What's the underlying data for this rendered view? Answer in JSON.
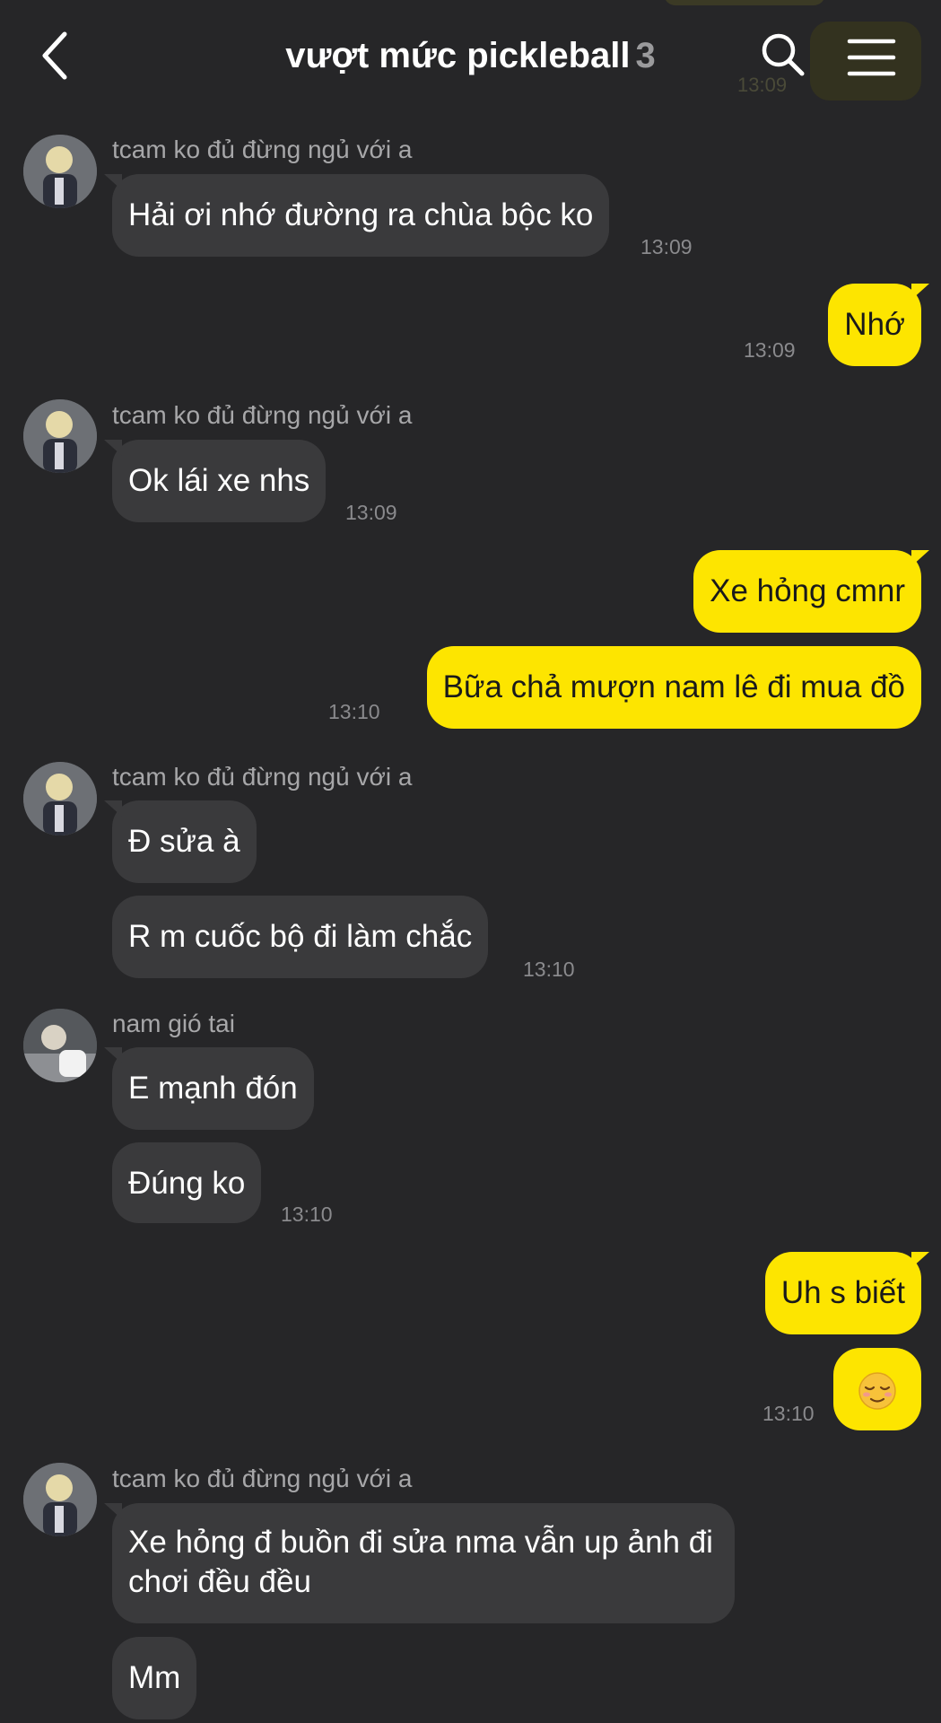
{
  "header": {
    "title": "vượt mức pickleball",
    "member_count": "3",
    "icons": {
      "back": "chevron-left-icon",
      "search": "search-icon",
      "menu": "hamburger-menu-icon"
    },
    "ghost_time": "13:09"
  },
  "colors": {
    "background": "#262628",
    "incoming_bubble": "#3a3a3c",
    "outgoing_bubble": "#fde500",
    "timestamp": "#8a8a8d",
    "sender_name": "#a7a7a9"
  },
  "messages": [
    {
      "sender": "tcam ko đủ đừng ngủ với a",
      "text": "Hải ơi nhớ đường ra chùa bộc ko",
      "time": "13:09"
    },
    {
      "text": "Nhớ",
      "time": "13:09"
    },
    {
      "sender": "tcam ko đủ đừng ngủ với a",
      "text": "Ok lái xe nhs",
      "time": "13:09"
    },
    {
      "text": "Xe hỏng cmnr"
    },
    {
      "text": "Bữa chả mượn nam lê đi mua đồ",
      "time": "13:10"
    },
    {
      "sender": "tcam ko đủ đừng ngủ với a",
      "text": "Đ sửa à"
    },
    {
      "text": "R m cuốc bộ đi làm chắc",
      "time": "13:10"
    },
    {
      "sender": "nam gió tai",
      "text": "E mạnh đón"
    },
    {
      "text": "Đúng ko",
      "time": "13:10"
    },
    {
      "text": "Uh s biết"
    },
    {
      "text": "😌",
      "emoji_name": "relieved-face-icon",
      "time": "13:10"
    },
    {
      "sender": "tcam ko đủ đừng ngủ với a",
      "text": "Xe hỏng đ buồn đi sửa nma vẫn up ảnh đi chơi đều đều"
    },
    {
      "text": "Mm"
    }
  ]
}
